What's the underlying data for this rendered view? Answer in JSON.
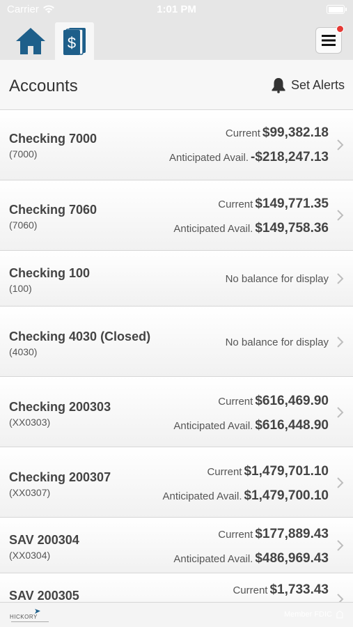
{
  "status_bar": {
    "carrier": "Carrier",
    "time": "1:01 PM"
  },
  "nav": {
    "home_icon": "home-icon",
    "accounts_icon": "dollar-document-icon",
    "menu_icon": "hamburger-menu-icon",
    "accent_color": "#1e5f8a",
    "notification_color": "#e53935"
  },
  "header": {
    "title": "Accounts",
    "alerts_label": "Set Alerts"
  },
  "accounts": [
    {
      "name": "Checking 7000",
      "number": "(7000)",
      "current_label": "Current",
      "current": "$99,382.18",
      "anticipated_label": "Anticipated Avail.",
      "anticipated": "-$218,247.13"
    },
    {
      "name": "Checking 7060",
      "number": "(7060)",
      "current_label": "Current",
      "current": "$149,771.35",
      "anticipated_label": "Anticipated Avail.",
      "anticipated": "$149,758.36"
    },
    {
      "name": "Checking 100",
      "number": "(100)",
      "no_balance": "No balance for display"
    },
    {
      "name": "Checking 4030 (Closed)",
      "number": "(4030)",
      "no_balance": "No balance for display"
    },
    {
      "name": "Checking 200303",
      "number": "(XX0303)",
      "current_label": "Current",
      "current": "$616,469.90",
      "anticipated_label": "Anticipated Avail.",
      "anticipated": "$616,448.90"
    },
    {
      "name": "Checking 200307",
      "number": "(XX0307)",
      "current_label": "Current",
      "current": "$1,479,701.10",
      "anticipated_label": "Anticipated Avail.",
      "anticipated": "$1,479,700.10"
    },
    {
      "name": "SAV 200304",
      "number": "(XX0304)",
      "current_label": "Current",
      "current": "$177,889.43",
      "anticipated_label": "Anticipated Avail.",
      "anticipated": "$486,969.43"
    },
    {
      "name": "SAV 200305",
      "current_label": "Current",
      "current": "$1,733.43"
    }
  ],
  "footer": {
    "logo_text": "HICKORY",
    "fdic": "Member FDIC"
  }
}
